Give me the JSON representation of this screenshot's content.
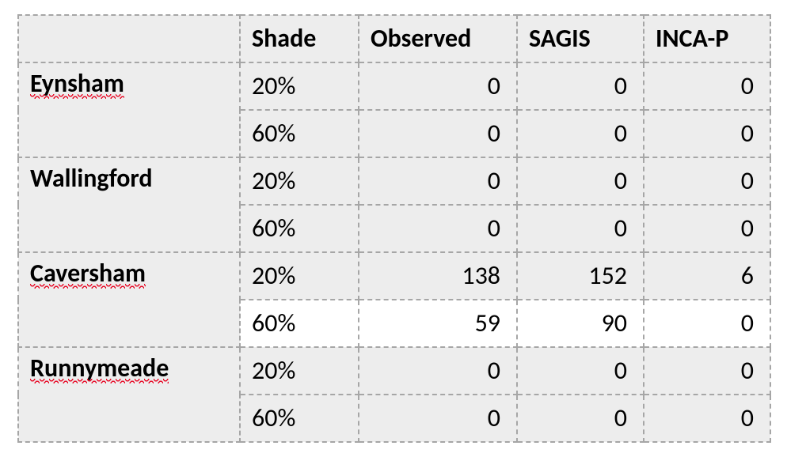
{
  "chart_data": {
    "type": "table",
    "columns": [
      "",
      "Shade",
      "Observed",
      "SAGIS",
      "INCA-P"
    ],
    "rows": [
      [
        "Eynsham",
        "20%",
        0,
        0,
        0
      ],
      [
        "Eynsham",
        "60%",
        0,
        0,
        0
      ],
      [
        "Wallingford",
        "20%",
        0,
        0,
        0
      ],
      [
        "Wallingford",
        "60%",
        0,
        0,
        0
      ],
      [
        "Caversham",
        "20%",
        138,
        152,
        6
      ],
      [
        "Caversham",
        "60%",
        59,
        90,
        0
      ],
      [
        "Runnymeade",
        "20%",
        0,
        0,
        0
      ],
      [
        "Runnymeade",
        "60%",
        0,
        0,
        0
      ]
    ]
  },
  "headers": {
    "blank": "",
    "shade": "Shade",
    "observed": "Observed",
    "sagis": "SAGIS",
    "incap": "INCA-P"
  },
  "groups": [
    {
      "name": "Eynsham",
      "spellcheck": true,
      "rows": [
        {
          "shade": "20%",
          "observed": "0",
          "sagis": "0",
          "incap": "0",
          "white": false
        },
        {
          "shade": "60%",
          "observed": "0",
          "sagis": "0",
          "incap": "0",
          "white": false
        }
      ]
    },
    {
      "name": "Wallingford",
      "spellcheck": false,
      "rows": [
        {
          "shade": "20%",
          "observed": "0",
          "sagis": "0",
          "incap": "0",
          "white": false
        },
        {
          "shade": "60%",
          "observed": "0",
          "sagis": "0",
          "incap": "0",
          "white": false
        }
      ]
    },
    {
      "name": "Caversham",
      "spellcheck": true,
      "rows": [
        {
          "shade": "20%",
          "observed": "138",
          "sagis": "152",
          "incap": "6",
          "white": false
        },
        {
          "shade": "60%",
          "observed": "59",
          "sagis": "90",
          "incap": "0",
          "white": true
        }
      ]
    },
    {
      "name": "Runnymeade",
      "spellcheck": true,
      "rows": [
        {
          "shade": "20%",
          "observed": "0",
          "sagis": "0",
          "incap": "0",
          "white": false
        },
        {
          "shade": "60%",
          "observed": "0",
          "sagis": "0",
          "incap": "0",
          "white": false
        }
      ]
    }
  ]
}
